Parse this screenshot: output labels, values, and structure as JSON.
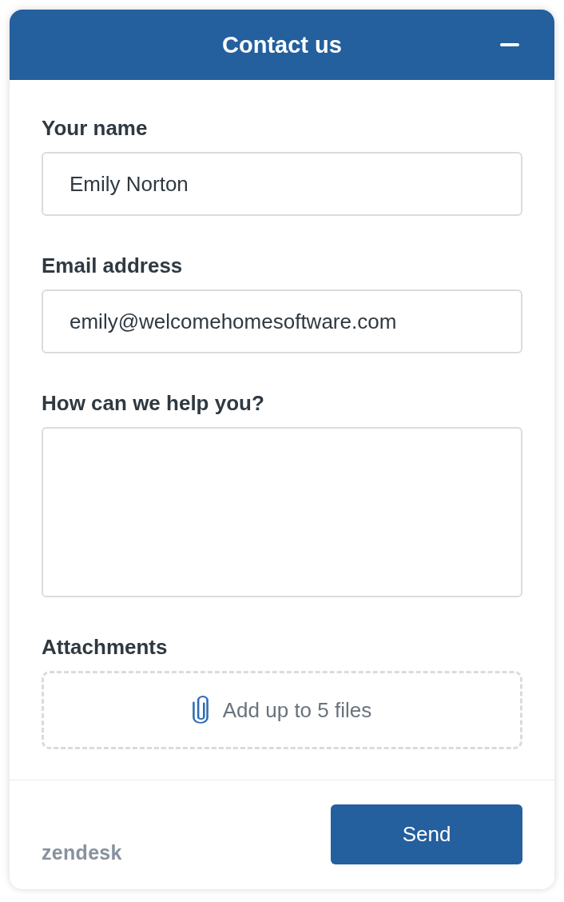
{
  "header": {
    "title": "Contact us"
  },
  "fields": [
    {
      "kind": "text",
      "label": "Your name",
      "value": "Emily Norton"
    },
    {
      "kind": "text",
      "label": "Email address",
      "value": "emily@welcomehomesoftware.com"
    },
    {
      "kind": "textarea",
      "label": "How can we help you?"
    },
    {
      "kind": "attachments",
      "label": "Attachments",
      "prompt": "Add up to 5 files"
    }
  ],
  "footer": {
    "logo": "zendesk",
    "button": "Send"
  }
}
